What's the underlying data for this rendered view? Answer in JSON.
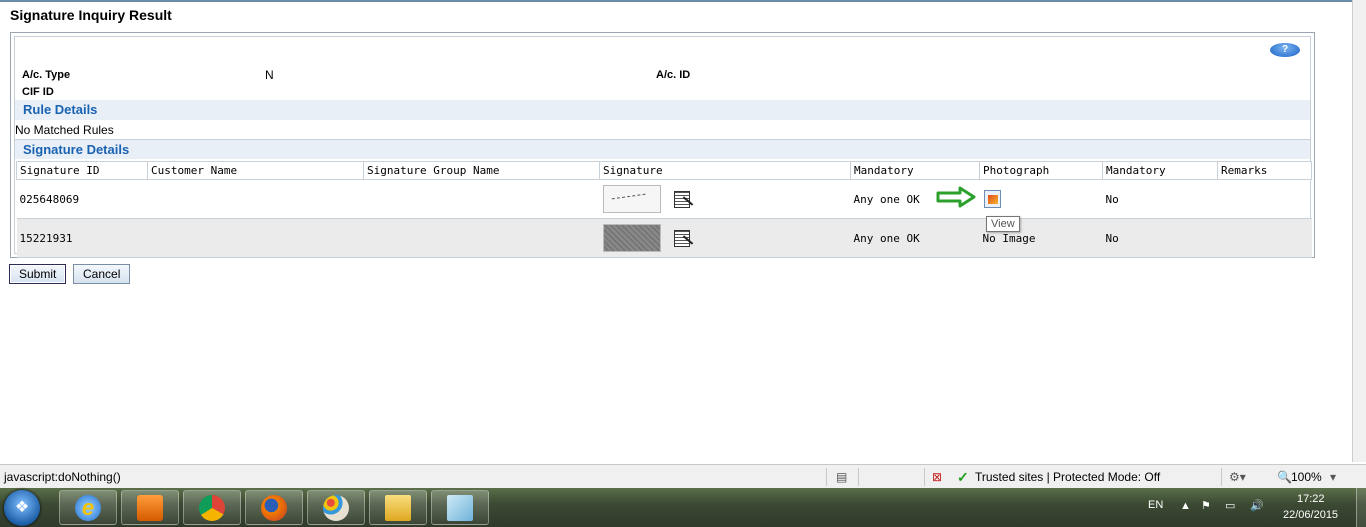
{
  "page": {
    "title": "Signature Inquiry Result",
    "help_label": "?"
  },
  "account": {
    "ac_type_label": "A/c. Type",
    "ac_type_value": "N",
    "ac_id_label": "A/c. ID",
    "cif_id_label": "CIF ID"
  },
  "rules": {
    "heading": "Rule Details",
    "text": "No Matched Rules"
  },
  "signatures": {
    "heading": "Signature Details",
    "columns": [
      "Signature ID",
      "Customer Name",
      "Signature Group Name",
      "Signature",
      "Mandatory",
      "Photograph",
      "Mandatory",
      "Remarks"
    ],
    "rows": [
      {
        "signature_id": "025648069",
        "customer_name": "",
        "group_name": "",
        "mandatory": "Any one OK",
        "photograph": "",
        "photo_mandatory": "No",
        "remarks": ""
      },
      {
        "signature_id": "15221931",
        "customer_name": "",
        "group_name": "",
        "mandatory": "Any one OK",
        "photograph": "No Image",
        "photo_mandatory": "No",
        "remarks": ""
      }
    ]
  },
  "tooltip": "View",
  "buttons": {
    "submit": "Submit",
    "cancel": "Cancel"
  },
  "statusbar": {
    "status_text": "javascript:doNothing()",
    "zone_text": "Trusted sites | Protected Mode: Off",
    "zoom": "100%"
  },
  "taskbar": {
    "language": "EN",
    "time": "17:22",
    "date": "22/06/2015",
    "apps": [
      "internet-explorer",
      "media-player",
      "chrome",
      "firefox",
      "paint",
      "file-explorer",
      "notepad"
    ]
  },
  "colors": {
    "section_heading": "#1a62b2",
    "section_band": "#e8eff7",
    "arrow": "#2ca02c"
  }
}
